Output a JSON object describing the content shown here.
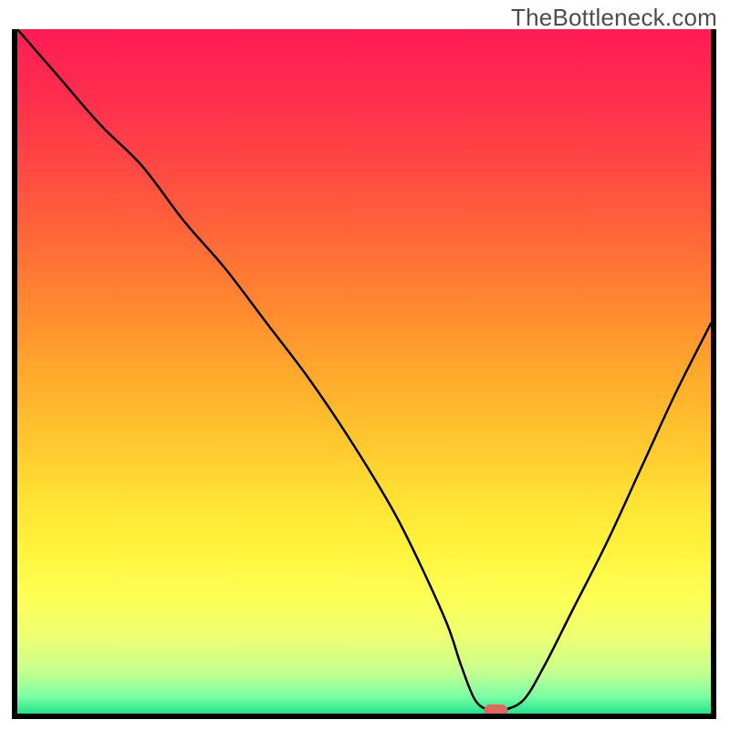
{
  "watermark": "TheBottleneck.com",
  "chart_data": {
    "type": "line",
    "title": "",
    "xlabel": "",
    "ylabel": "",
    "xlim": [
      0,
      100
    ],
    "ylim": [
      0,
      100
    ],
    "background_gradient_stops": [
      {
        "offset": 0.0,
        "color": "#ff1c54"
      },
      {
        "offset": 0.1,
        "color": "#ff2e4e"
      },
      {
        "offset": 0.2,
        "color": "#ff4844"
      },
      {
        "offset": 0.3,
        "color": "#ff6638"
      },
      {
        "offset": 0.4,
        "color": "#ff8730"
      },
      {
        "offset": 0.5,
        "color": "#ffa82c"
      },
      {
        "offset": 0.6,
        "color": "#ffc62e"
      },
      {
        "offset": 0.68,
        "color": "#ffe033"
      },
      {
        "offset": 0.76,
        "color": "#fff33c"
      },
      {
        "offset": 0.83,
        "color": "#fdff55"
      },
      {
        "offset": 0.89,
        "color": "#edff72"
      },
      {
        "offset": 0.94,
        "color": "#c4ff8f"
      },
      {
        "offset": 0.975,
        "color": "#7bffa5"
      },
      {
        "offset": 1.0,
        "color": "#22e28a"
      }
    ],
    "series": [
      {
        "name": "bottleneck-curve",
        "color": "#000000",
        "x": [
          0,
          6,
          12,
          18,
          24,
          30,
          36,
          42,
          48,
          54,
          58,
          62,
          64,
          66,
          68,
          70,
          73,
          76,
          80,
          85,
          90,
          95,
          100
        ],
        "y": [
          100,
          93,
          86,
          80,
          72,
          65,
          57,
          49,
          40,
          30,
          22,
          13,
          7,
          2,
          0.5,
          0.5,
          2,
          7,
          15,
          25,
          36,
          47,
          57
        ]
      }
    ],
    "marker": {
      "name": "optimal-point",
      "x": 69,
      "y": 0.4,
      "color": "#e0685f",
      "shape": "rounded-rect"
    }
  }
}
